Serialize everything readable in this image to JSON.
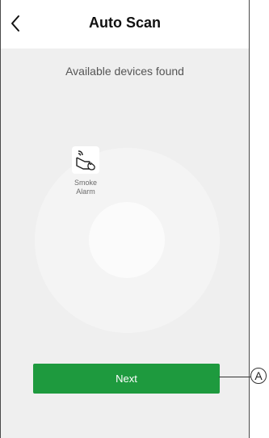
{
  "header": {
    "title": "Auto Scan",
    "back_icon": "chevron-left-icon"
  },
  "scan": {
    "subtitle": "Available devices found",
    "devices": [
      {
        "name": "Smoke\nAlarm",
        "icon": "smoke-alarm-icon"
      }
    ]
  },
  "footer": {
    "next_label": "Next"
  },
  "annotation": {
    "callout_label": "A"
  },
  "colors": {
    "accent": "#1e9a3e",
    "background": "#efefef",
    "header_background": "#ffffff"
  }
}
